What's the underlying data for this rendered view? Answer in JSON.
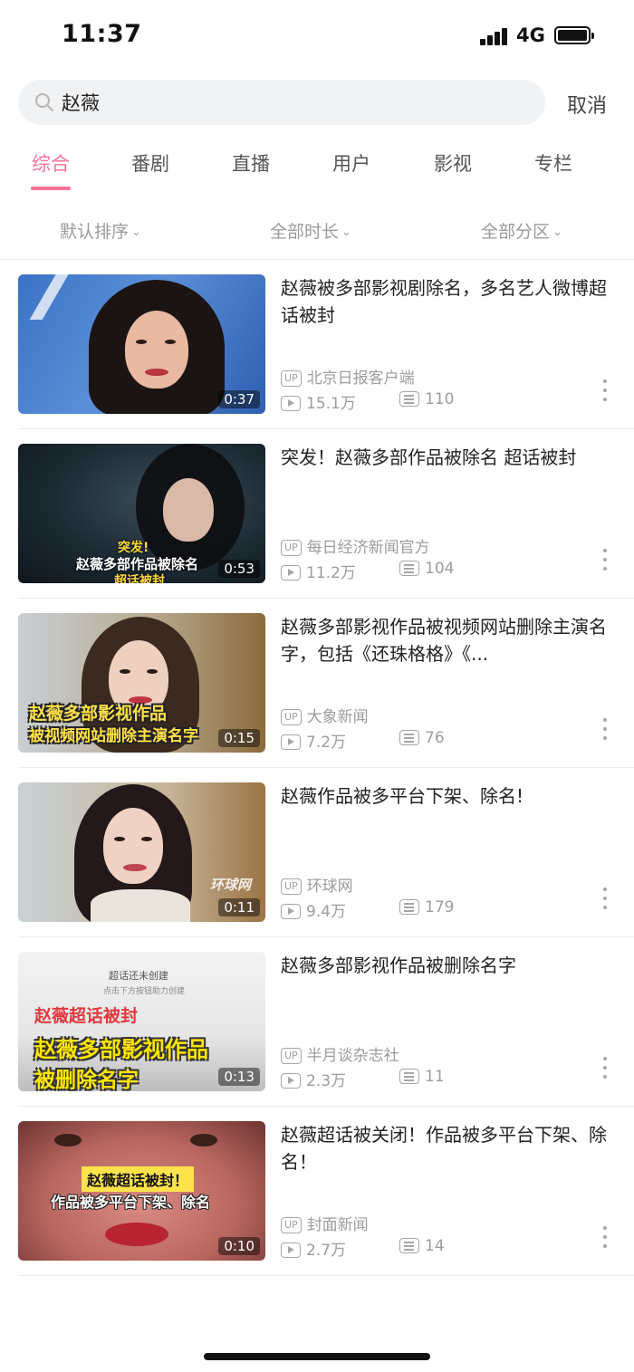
{
  "status_bar": {
    "time": "11:37",
    "network": "4G"
  },
  "search": {
    "value": "赵薇",
    "cancel_label": "取消"
  },
  "tabs": [
    {
      "label": "综合",
      "active": true
    },
    {
      "label": "番剧",
      "active": false
    },
    {
      "label": "直播",
      "active": false
    },
    {
      "label": "用户",
      "active": false
    },
    {
      "label": "影视",
      "active": false
    },
    {
      "label": "专栏",
      "active": false
    }
  ],
  "filters": [
    {
      "label": "默认排序"
    },
    {
      "label": "全部时长"
    },
    {
      "label": "全部分区"
    }
  ],
  "up_badge": "UP",
  "accent_color": "#fb7299",
  "results": [
    {
      "title": "赵薇被多部影视剧除名，多名艺人微博超话被封",
      "author": "北京日报客户端",
      "views": "15.1万",
      "danmaku": "110",
      "duration": "0:37",
      "overlay": []
    },
    {
      "title": "突发！赵薇多部作品被除名 超话被封",
      "author": "每日经济新闻官方",
      "views": "11.2万",
      "danmaku": "104",
      "duration": "0:53",
      "overlay": [
        "突发!",
        "赵薇多部作品被除名",
        "超话被封"
      ]
    },
    {
      "title": "赵薇多部影视作品被视频网站删除主演名字，包括《还珠格格》《...",
      "author": "大象新闻",
      "views": "7.2万",
      "danmaku": "76",
      "duration": "0:15",
      "overlay": [
        "赵薇多部影视作品",
        "被视频网站删除主演名字"
      ]
    },
    {
      "title": "赵薇作品被多平台下架、除名!",
      "author": "环球网",
      "views": "9.4万",
      "danmaku": "179",
      "duration": "0:11",
      "overlay": [
        "环球网"
      ]
    },
    {
      "title": "赵薇多部影视作品被删除名字",
      "author": "半月谈杂志社",
      "views": "2.3万",
      "danmaku": "11",
      "duration": "0:13",
      "overlay": [
        "超话还未创建",
        "点击下方按钮助力创建",
        "赵薇超话被封",
        "赵薇多部影视作品",
        "被删除名字"
      ]
    },
    {
      "title": "赵薇超话被关闭！作品被多平台下架、除名！",
      "author": "封面新闻",
      "views": "2.7万",
      "danmaku": "14",
      "duration": "0:10",
      "overlay": [
        "赵薇超话被封！",
        "作品被多平台下架、除名"
      ]
    }
  ]
}
